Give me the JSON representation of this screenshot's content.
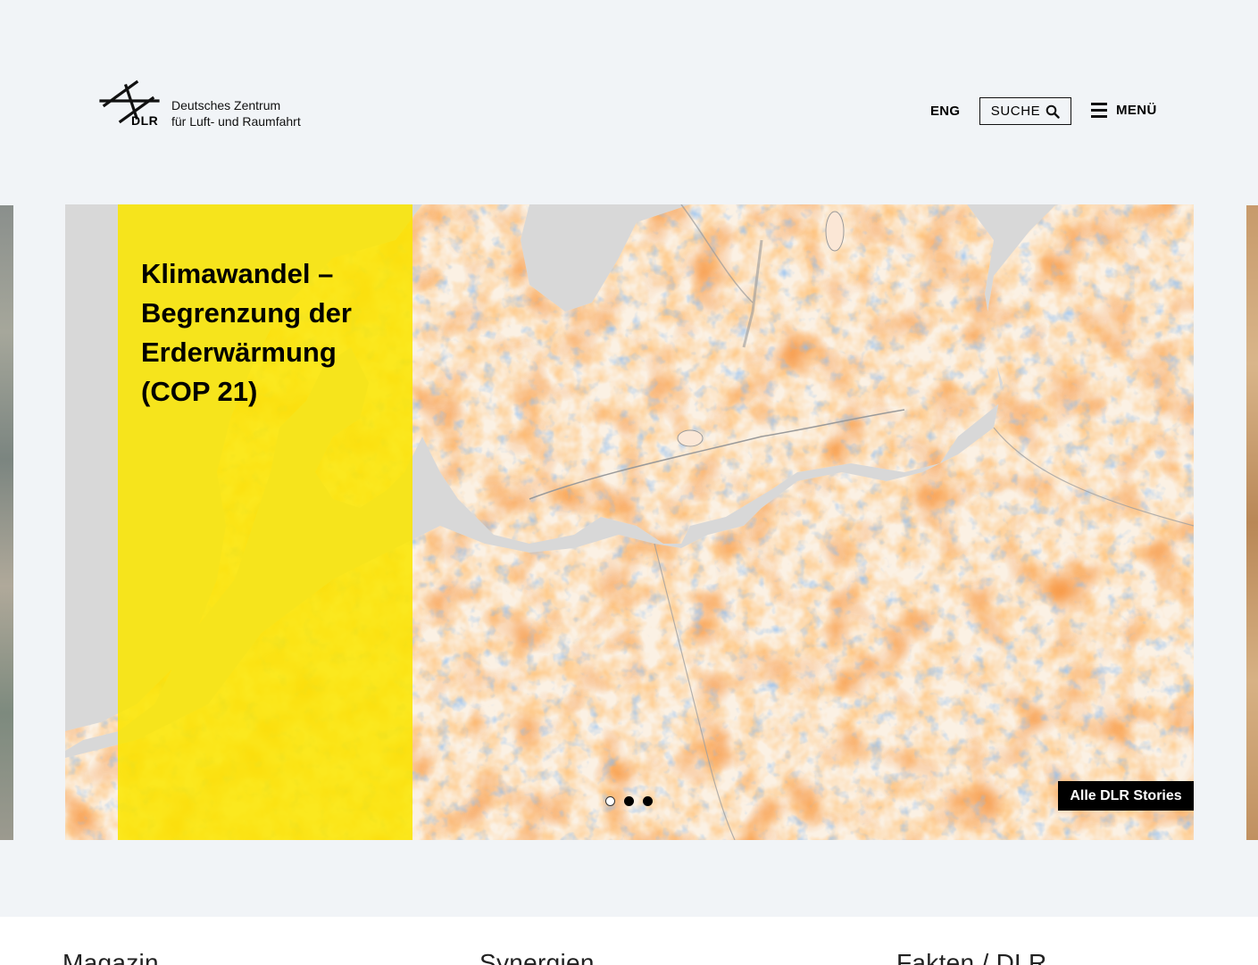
{
  "header": {
    "logo": {
      "abbr": "DLR",
      "line1": "Deutsches Zentrum",
      "line2": "für Luft- und Raumfahrt"
    },
    "language_label": "ENG",
    "search_label": "SUCHE",
    "menu_label": "MENÜ"
  },
  "hero": {
    "title": "Klimawandel – Begrenzung der Erderwärmung (COP 21)",
    "all_stories_label": "Alle DLR Stories",
    "slide_count": 3,
    "active_slide": 1
  },
  "bottom_nav": {
    "items": [
      "Magazin",
      "Synergien",
      "Fakten / DLR"
    ]
  },
  "colors": {
    "background": "#f1f4f7",
    "accent_yellow": "#fae600",
    "map_orange": "#f2641e",
    "map_blue": "#3f7fd6",
    "sea_gray": "#d8d8d8"
  }
}
